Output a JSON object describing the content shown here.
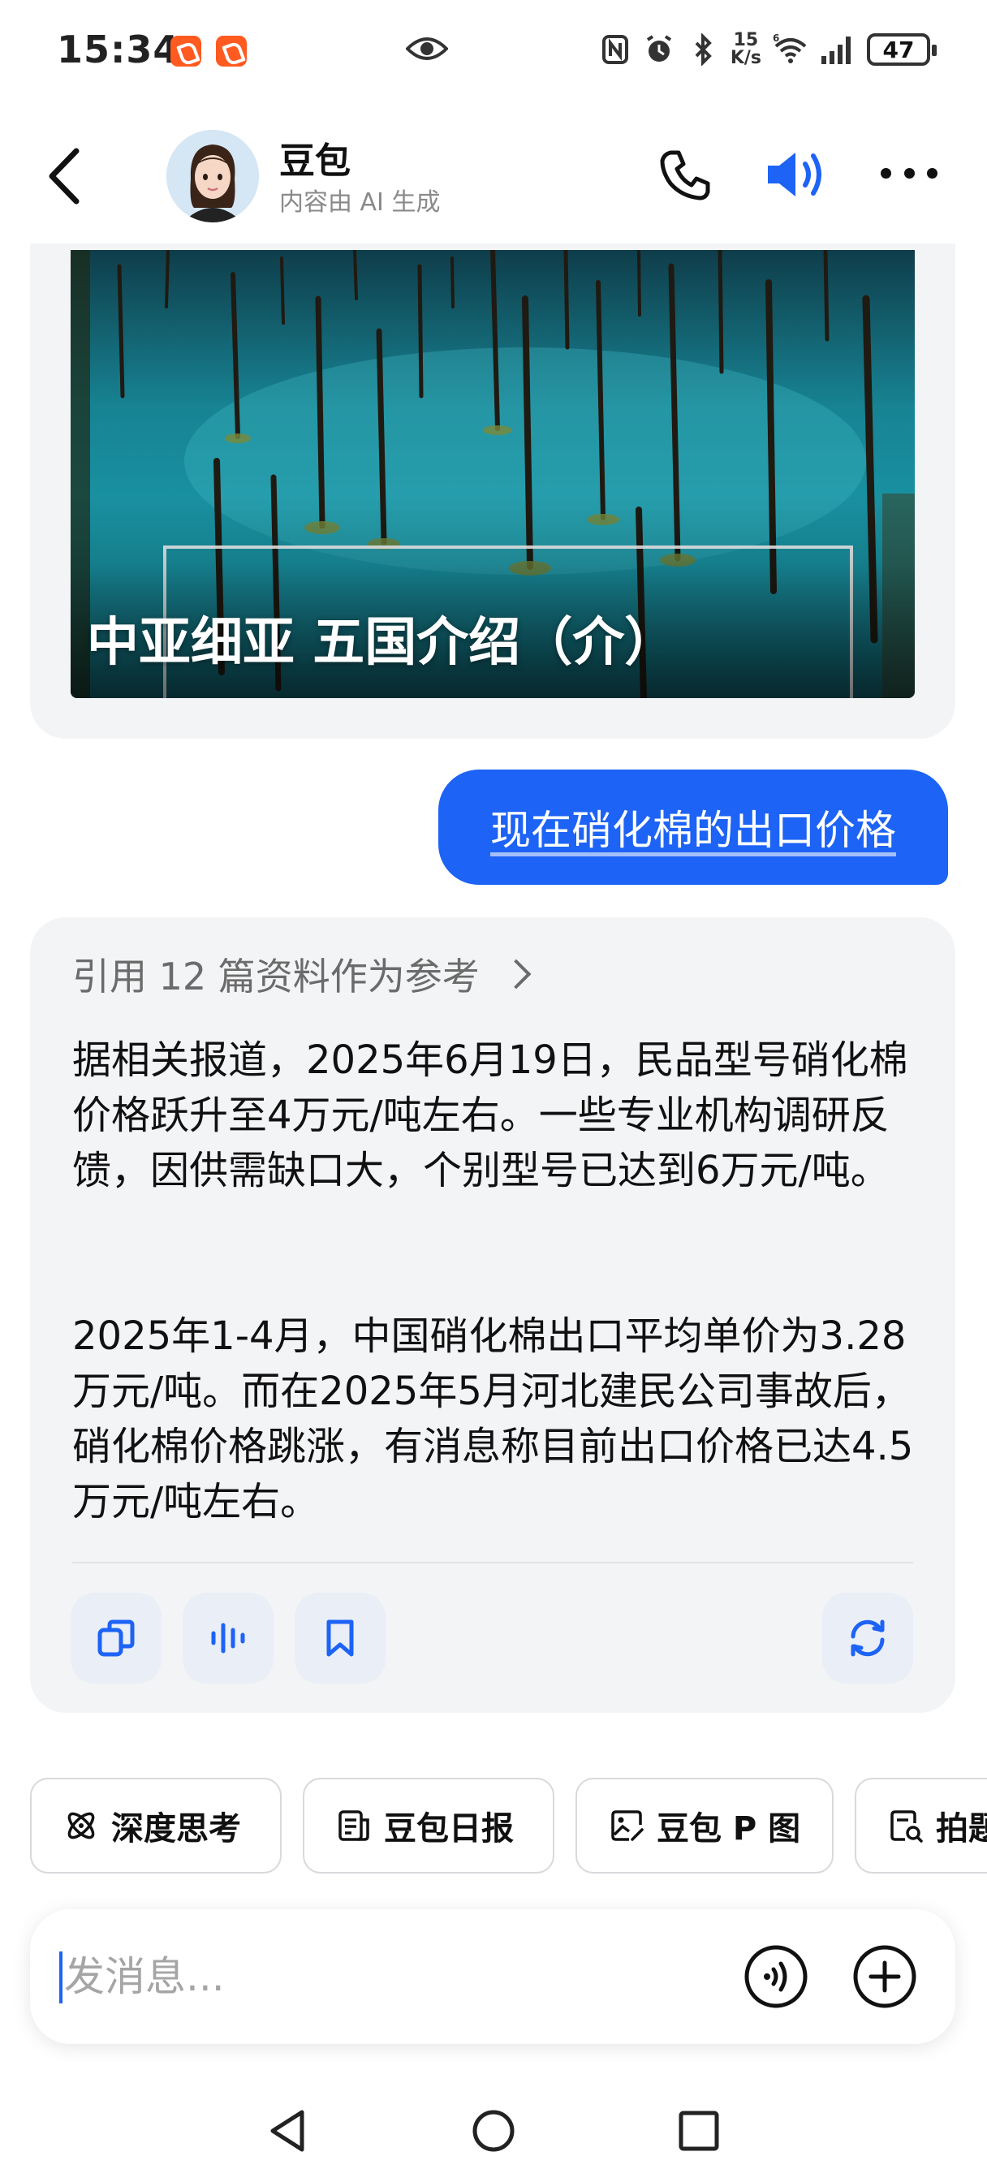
{
  "status_bar": {
    "time": "15:34",
    "net_speed_value": "15",
    "net_speed_unit": "K/s",
    "signal_label": "6",
    "battery": "47"
  },
  "header": {
    "name": "豆包",
    "subtitle": "内容由 AI 生成"
  },
  "image_card": {
    "title": "中亚细亚 五国介绍（介）"
  },
  "user_message": "现在硝化棉的出口价格",
  "ai_message": {
    "reference": "引用 12 篇资料作为参考",
    "paragraph_1": "据相关报道，2025年6月19日，民品型号硝化棉价格跃升至4万元/吨左右。一些专业机构调研反馈，因供需缺口大，个别型号已达到6万元/吨。",
    "paragraph_2": "2025年1-4月，中国硝化棉出口平均单价为3.28万元/吨。而在2025年5月河北建民公司事故后，硝化棉价格跳涨，有消息称目前出口价格已达4.5万元/吨左右。"
  },
  "shortcuts": [
    {
      "label": "深度思考",
      "icon": "atom-icon"
    },
    {
      "label": "豆包日报",
      "icon": "newspaper-icon"
    },
    {
      "label": "豆包 P 图",
      "icon": "image-edit-icon"
    },
    {
      "label": "拍题",
      "icon": "scan-doc-icon"
    }
  ],
  "input": {
    "placeholder": "发消息..."
  },
  "colors": {
    "accent": "#1d63f5",
    "card_bg": "#f3f4f6",
    "action_bg": "#e9eef7"
  }
}
